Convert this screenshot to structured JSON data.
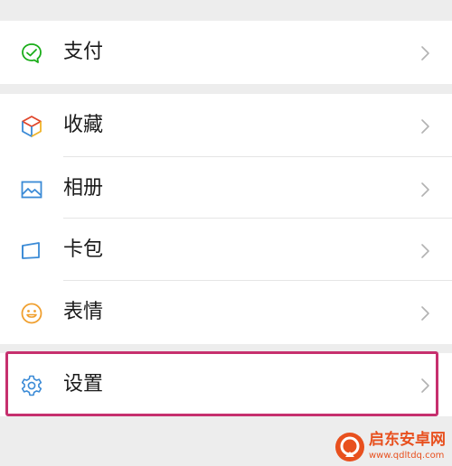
{
  "menu": {
    "items": [
      {
        "label": "支付",
        "icon": "wechat-pay-icon"
      },
      {
        "label": "收藏",
        "icon": "favorites-cube-icon"
      },
      {
        "label": "相册",
        "icon": "album-picture-icon"
      },
      {
        "label": "卡包",
        "icon": "card-wallet-icon"
      },
      {
        "label": "表情",
        "icon": "smiley-face-icon"
      },
      {
        "label": "设置",
        "icon": "settings-gear-icon"
      }
    ],
    "chevron_icon": "chevron-right-icon",
    "highlighted_item": "设置"
  },
  "watermark": {
    "title": "启东安卓网",
    "url": "www.qdltdq.com"
  },
  "colors": {
    "background": "#ededed",
    "row_background": "#ffffff",
    "highlight_border": "#c6306e",
    "pay_green": "#1aad19",
    "icon_blue": "#3a8ad6",
    "smiley_orange": "#f0a030",
    "watermark_orange": "#e8501e"
  }
}
